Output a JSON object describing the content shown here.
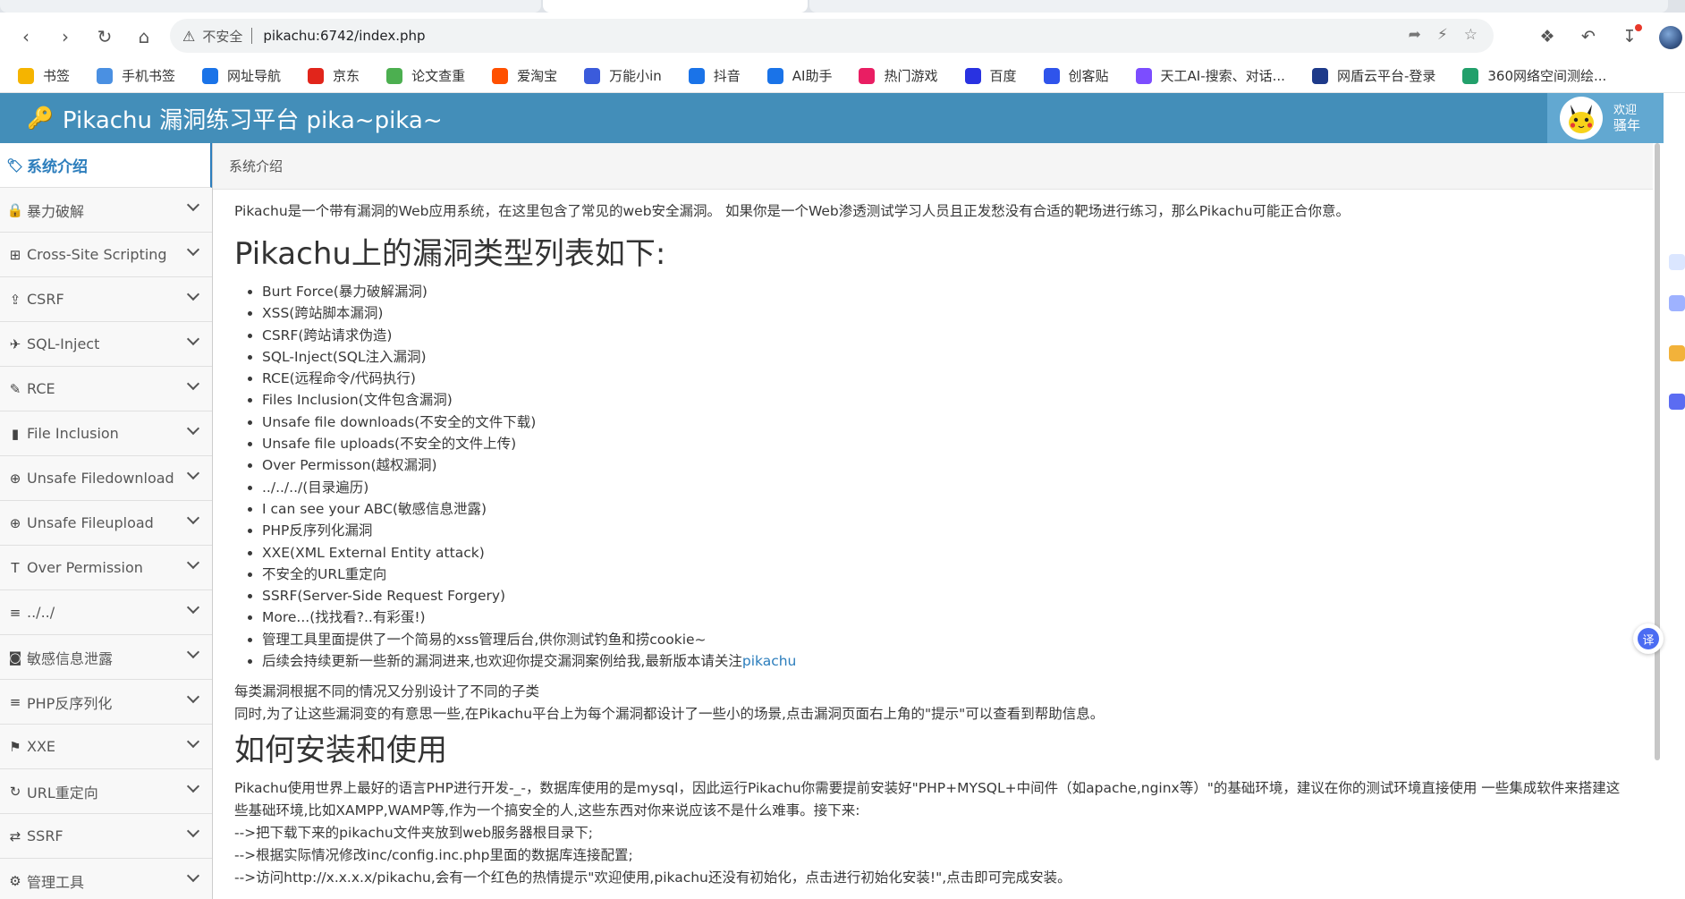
{
  "browser": {
    "address": {
      "insecure_label": "不安全",
      "url": "pikachu:6742/index.php"
    },
    "icons": [
      "back-icon",
      "forward-icon",
      "reload-icon",
      "home-icon",
      "warning-icon",
      "share-icon",
      "lightning-icon",
      "star-icon",
      "extensions-icon",
      "undo-icon",
      "download-icon",
      "profile-avatar"
    ],
    "bookmarks": [
      {
        "label": "书签",
        "icon": "star-icon",
        "color": "#f5b400"
      },
      {
        "label": "手机书签",
        "icon": "phone-icon",
        "color": "#4a90e2"
      },
      {
        "label": "网址导航",
        "icon": "e-icon",
        "color": "#1a73e8"
      },
      {
        "label": "京东",
        "icon": "jd-icon",
        "color": "#e1251b"
      },
      {
        "label": "论文查重",
        "icon": "pp-icon",
        "color": "#4caf50"
      },
      {
        "label": "爱淘宝",
        "icon": "taobao-icon",
        "color": "#ff5000"
      },
      {
        "label": "万能小in",
        "icon": "robot-icon",
        "color": "#3b5bdb"
      },
      {
        "label": "抖音",
        "icon": "e-icon",
        "color": "#1a73e8"
      },
      {
        "label": "AI助手",
        "icon": "e-icon",
        "color": "#1a73e8"
      },
      {
        "label": "热门游戏",
        "icon": "game-icon",
        "color": "#e91e63"
      },
      {
        "label": "百度",
        "icon": "paw-icon",
        "color": "#2932e1"
      },
      {
        "label": "创客贴",
        "icon": "cube-icon",
        "color": "#2f54eb"
      },
      {
        "label": "天工AI-搜索、对话...",
        "icon": "swirl-icon",
        "color": "#7c4dff"
      },
      {
        "label": "网盾云平台-登录",
        "icon": "shield-icon",
        "color": "#1e3a8a"
      },
      {
        "label": "360网络空间测绘...",
        "icon": "globe-icon",
        "color": "#22a06b"
      }
    ]
  },
  "header": {
    "title": "Pikachu 漏洞练习平台 pika~pika~",
    "welcome": "欢迎",
    "user": "骚年"
  },
  "sidebar": {
    "items": [
      {
        "label": "系统介绍",
        "icon": "tag-icon",
        "glyph": "🏷",
        "active": true
      },
      {
        "label": "暴力破解",
        "icon": "lock-icon",
        "glyph": "🔒"
      },
      {
        "label": "Cross-Site Scripting",
        "icon": "sitemap-icon",
        "glyph": "⊞"
      },
      {
        "label": "CSRF",
        "icon": "share-square-icon",
        "glyph": "⇪"
      },
      {
        "label": "SQL-Inject",
        "icon": "fighter-jet-icon",
        "glyph": "✈"
      },
      {
        "label": "RCE",
        "icon": "pencil-icon",
        "glyph": "✎"
      },
      {
        "label": "File Inclusion",
        "icon": "file-icon",
        "glyph": "▮"
      },
      {
        "label": "Unsafe Filedownload",
        "icon": "download-circle-icon",
        "glyph": "⊕"
      },
      {
        "label": "Unsafe Fileupload",
        "icon": "upload-circle-icon",
        "glyph": "⊕"
      },
      {
        "label": "Over Permission",
        "icon": "text-height-icon",
        "glyph": "T"
      },
      {
        "label": "../../",
        "icon": "list-icon",
        "glyph": "≡"
      },
      {
        "label": "敏感信息泄露",
        "icon": "camera-icon",
        "glyph": "◙"
      },
      {
        "label": "PHP反序列化",
        "icon": "align-left-icon",
        "glyph": "≡"
      },
      {
        "label": "XXE",
        "icon": "flag-icon",
        "glyph": "⚑"
      },
      {
        "label": "URL重定向",
        "icon": "refresh-icon",
        "glyph": "↻"
      },
      {
        "label": "SSRF",
        "icon": "exchange-icon",
        "glyph": "⇄"
      },
      {
        "label": "管理工具",
        "icon": "cog-icon",
        "glyph": "⚙"
      }
    ]
  },
  "main": {
    "breadcrumb": "系统介绍",
    "intro": "Pikachu是一个带有漏洞的Web应用系统，在这里包含了常见的web安全漏洞。 如果你是一个Web渗透测试学习人员且正发愁没有合适的靶场进行练习，那么Pikachu可能正合你意。",
    "h1": "Pikachu上的漏洞类型列表如下:",
    "vuln_list": [
      "Burt Force(暴力破解漏洞)",
      "XSS(跨站脚本漏洞)",
      "CSRF(跨站请求伪造)",
      "SQL-Inject(SQL注入漏洞)",
      "RCE(远程命令/代码执行)",
      "Files Inclusion(文件包含漏洞)",
      "Unsafe file downloads(不安全的文件下载)",
      "Unsafe file uploads(不安全的文件上传)",
      "Over Permisson(越权漏洞)",
      "../../../(目录遍历)",
      "I can see your ABC(敏感信息泄露)",
      "PHP反序列化漏洞",
      "XXE(XML External Entity attack)",
      "不安全的URL重定向",
      "SSRF(Server-Side Request Forgery)",
      "More...(找找看?..有彩蛋!)",
      "管理工具里面提供了一个简易的xss管理后台,供你测试钓鱼和捞cookie~"
    ],
    "last_item_text": "后续会持续更新一些新的漏洞进来,也欢迎你提交漏洞案例给我,最新版本请关注",
    "last_item_link": "pikachu",
    "para1": "每类漏洞根据不同的情况又分别设计了不同的子类",
    "para2": "同时,为了让这些漏洞变的有意思一些,在Pikachu平台上为每个漏洞都设计了一些小的场景,点击漏洞页面右上角的\"提示\"可以查看到帮助信息。",
    "h2": "如何安装和使用",
    "install1": "Pikachu使用世界上最好的语言PHP进行开发-_-，数据库使用的是mysql，因此运行Pikachu你需要提前安装好\"PHP+MYSQL+中间件（如apache,nginx等）\"的基础环境，建议在你的测试环境直接使用 一些集成软件来搭建这些基础环境,比如XAMPP,WAMP等,作为一个搞安全的人,这些东西对你来说应该不是什么难事。接下来:",
    "step1": "-->把下载下来的pikachu文件夹放到web服务器根目录下;",
    "step2": "-->根据实际情况修改inc/config.inc.php里面的数据库连接配置;",
    "step3": "-->访问http://x.x.x.x/pikachu,会有一个红色的热情提示\"欢迎使用,pikachu还没有初始化，点击进行初始化安装!\",点击即可完成安装。"
  },
  "translate_badge": "译",
  "colors": {
    "header": "#438eb9",
    "user_area": "#62a8d1",
    "link": "#2b7dbc"
  }
}
